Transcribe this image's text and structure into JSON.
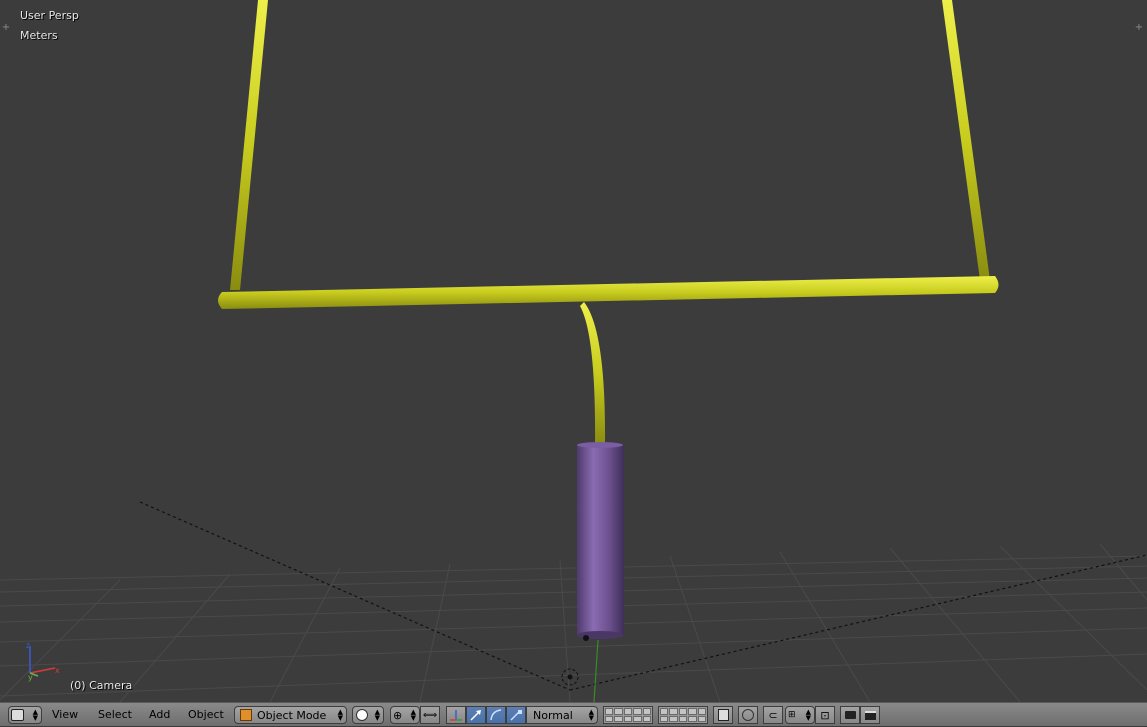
{
  "viewport": {
    "view_name": "User Persp",
    "units": "Meters",
    "object_info": "(0) Camera"
  },
  "colors": {
    "background": "#3c3c3c",
    "goalpost": "#c8cc1e",
    "padding": "#6a4f8c",
    "header": "#7a7a7a",
    "active_button": "#4872ad"
  },
  "header": {
    "editor_type_icon": "3d-view-icon",
    "menus": [
      "View",
      "Select",
      "Add",
      "Object"
    ],
    "mode": "Object Mode",
    "mode_icon": "cube-icon",
    "shading_icon": "solid-sphere-icon",
    "pivot_icon": "pivot-median-icon",
    "transform_orientation": "Normal"
  }
}
